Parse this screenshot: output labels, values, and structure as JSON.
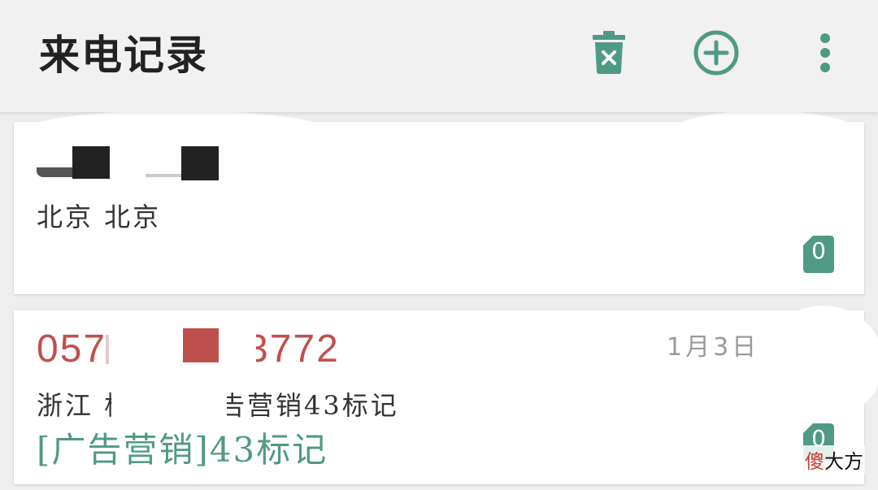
{
  "app_bar": {
    "title": "来电记录",
    "actions": [
      {
        "name": "clear-records",
        "icon": "trash-x-icon"
      },
      {
        "name": "add",
        "icon": "plus-circle-icon"
      },
      {
        "name": "more",
        "icon": "more-vert-icon"
      }
    ]
  },
  "colors": {
    "accent": "#4f9a85",
    "number_red": "#c0504d",
    "title": "#222222",
    "date_gray": "#9a9a9a"
  },
  "records": [
    {
      "location": "北京 北京",
      "sim": "0"
    },
    {
      "number_prefix": "057",
      "number_suffix": "3772",
      "date": "1月3日",
      "location": "浙江 杭",
      "location_tail": "告营销43标记",
      "tag": "[广告营销]43标记",
      "sim": "0"
    }
  ],
  "watermark": {
    "first": "傻",
    "rest": "大方"
  }
}
